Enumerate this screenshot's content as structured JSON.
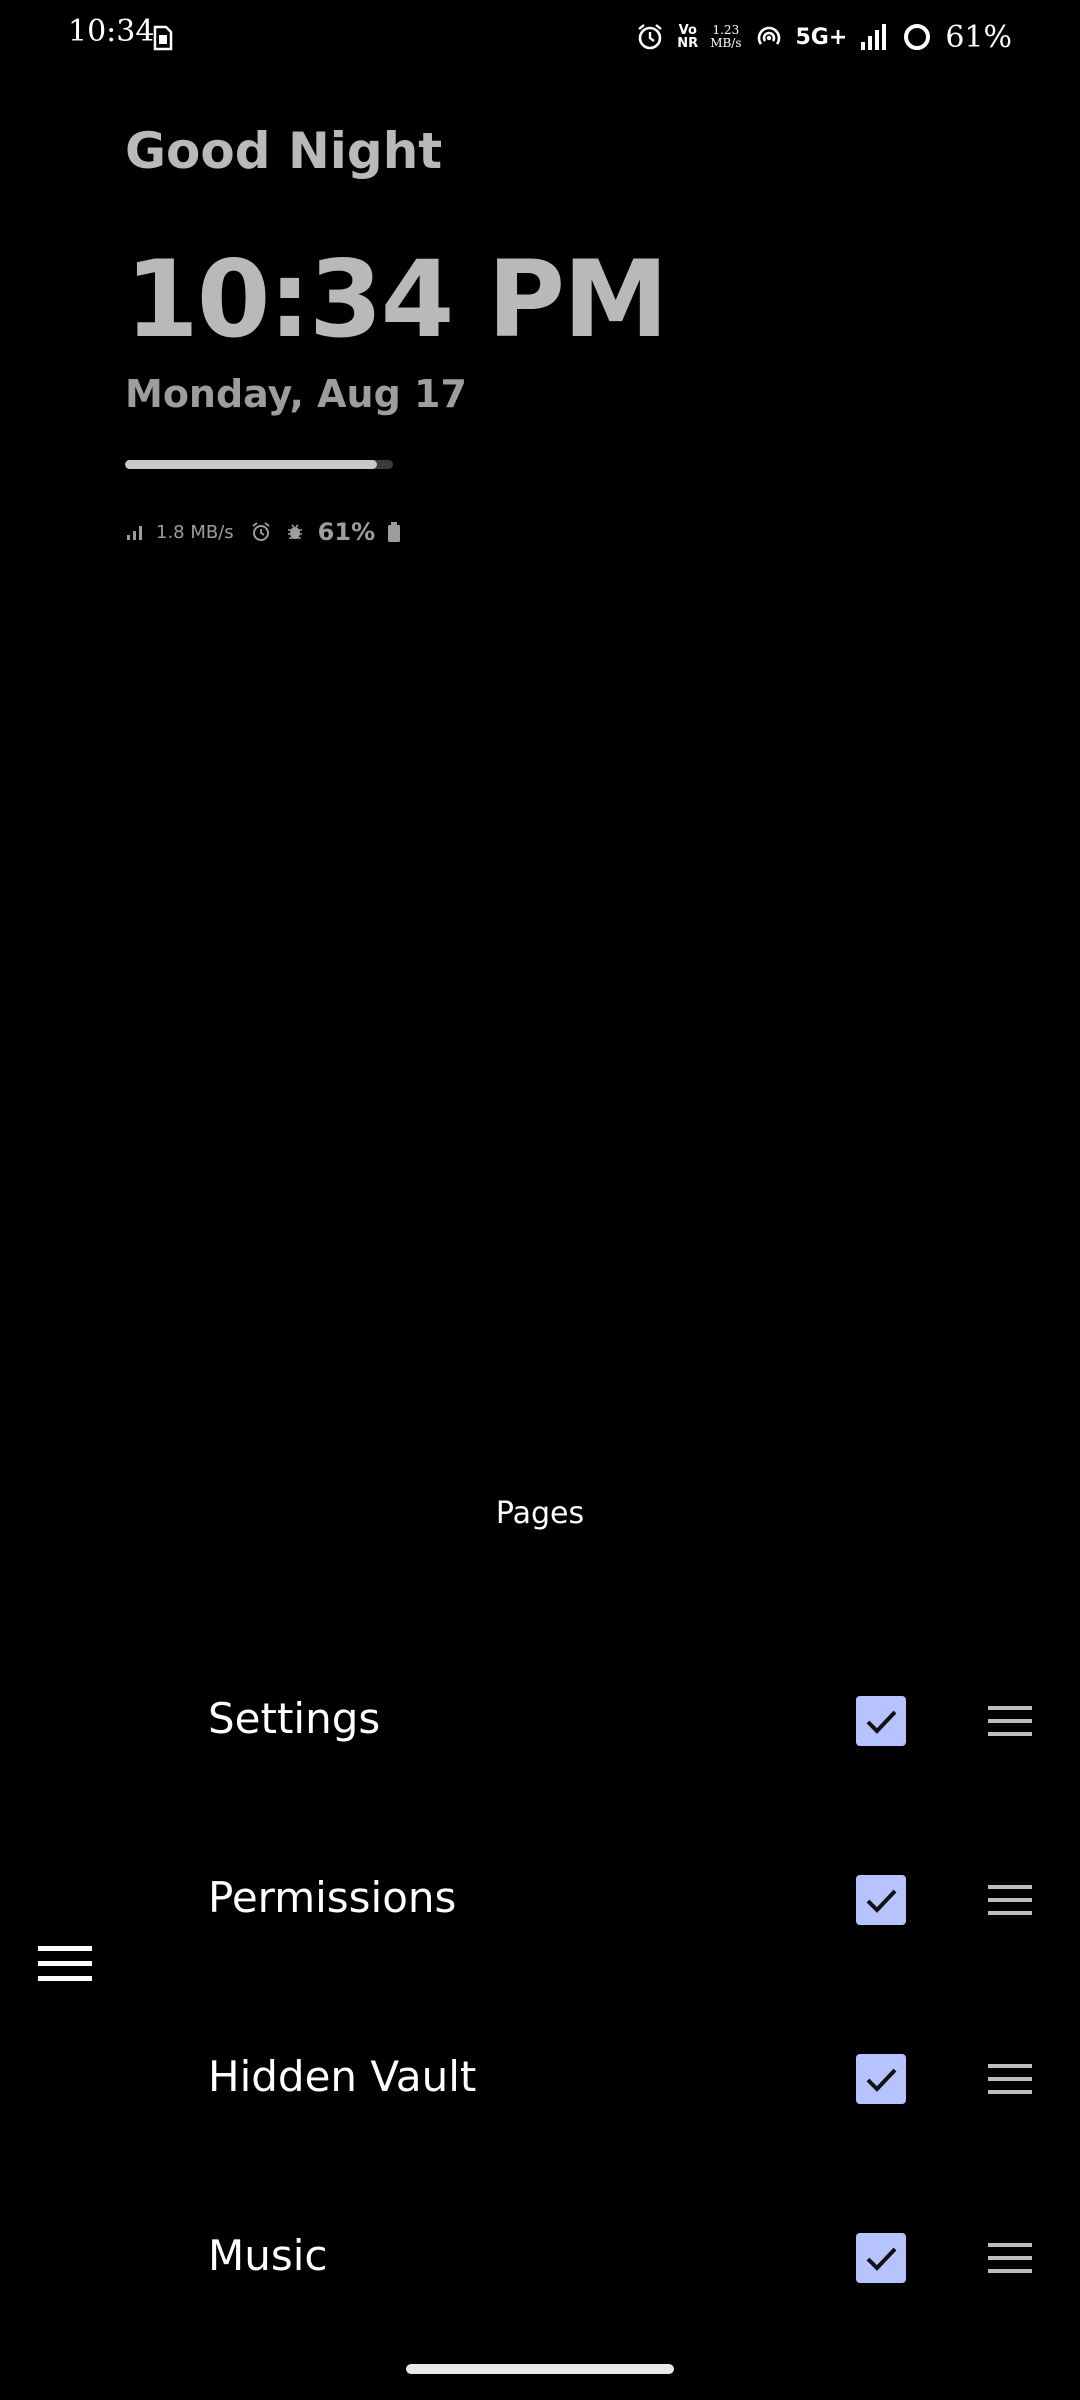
{
  "status_bar": {
    "time": "10:34",
    "vonr_top": "Vo",
    "vonr_bottom": "NR",
    "net_speed_top": "1.23",
    "net_speed_bottom": "MB/s",
    "network": "5G+",
    "battery": "61%",
    "icons": [
      "sim-card-icon",
      "alarm-icon",
      "hotspot-icon",
      "signal-icon",
      "battery-ring-icon"
    ]
  },
  "widget": {
    "greeting": "Good Night",
    "time": "10:34 PM",
    "date": "Monday, Aug 17",
    "day_progress": 0.94,
    "net_speed": "1.8 MB/s",
    "battery": "61%",
    "icons": [
      "signal-icon",
      "alarm-icon",
      "bug-icon",
      "battery-icon"
    ]
  },
  "pages": {
    "title": "Pages",
    "items": [
      {
        "label": "Settings",
        "checked": true
      },
      {
        "label": "Permissions",
        "checked": true
      },
      {
        "label": "Hidden Vault",
        "checked": true
      },
      {
        "label": "Music",
        "checked": true
      }
    ]
  },
  "colors": {
    "background": "#000000",
    "checkbox_fill": "#b7c3ff",
    "widget_text": "#b9b9b9"
  }
}
